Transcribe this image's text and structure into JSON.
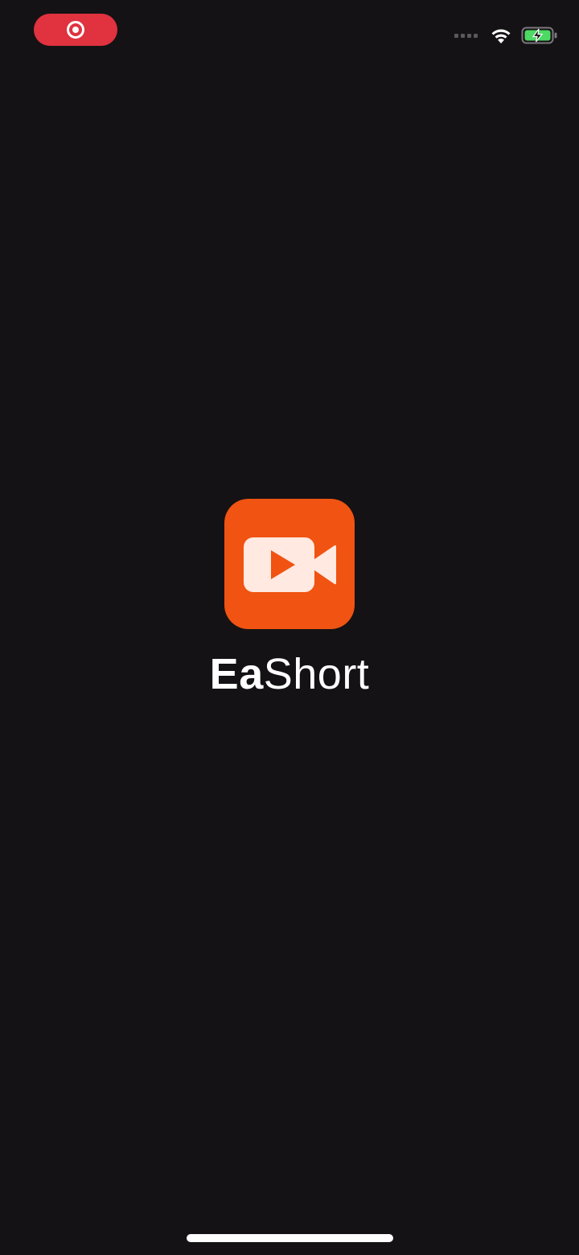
{
  "status_bar": {
    "recording_icon": "screen-recording-icon",
    "signal_icon": "cellular-signal-icon",
    "wifi_icon": "wifi-icon",
    "battery_icon": "battery-charging-icon",
    "recording_color": "#e0323f",
    "battery_color": "#4cd964"
  },
  "splash": {
    "app_icon": "video-camera-icon",
    "app_name_bold": "Ea",
    "app_name_light": "Short",
    "brand_color": "#f05312"
  }
}
